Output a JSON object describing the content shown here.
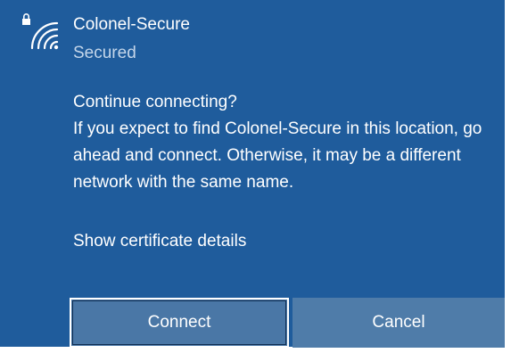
{
  "network": {
    "name": "Colonel-Secure",
    "status": "Secured"
  },
  "prompt": {
    "question": "Continue connecting?",
    "body": "If you expect to find Colonel-Secure in this location, go ahead and connect. Otherwise, it may be a different network with the same name."
  },
  "certificate_link": "Show certificate details",
  "buttons": {
    "connect": "Connect",
    "cancel": "Cancel"
  },
  "icons": {
    "wifi": "wifi-secured-icon"
  },
  "colors": {
    "panel_background": "#1f5c9c",
    "button_background": "#4a77a6",
    "secondary_text": "#c4d6ea"
  }
}
